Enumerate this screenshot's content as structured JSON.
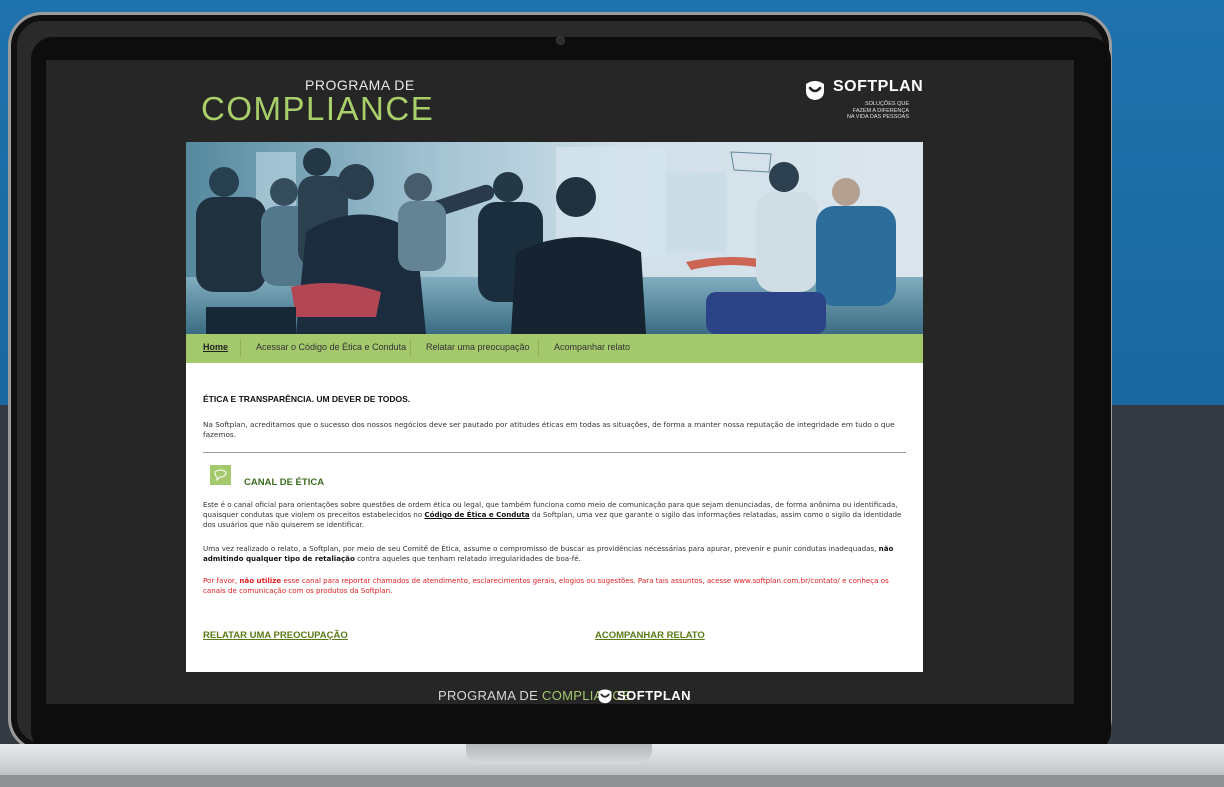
{
  "header": {
    "program_small": "PROGRAMA DE",
    "program_big": "COMPLIANCE",
    "logo_text": "SOFTPLAN",
    "logo_tagline_1": "SOLUÇÕES QUE",
    "logo_tagline_2": "FAZEM A DIFERENÇA",
    "logo_tagline_3": "NA VIDA DAS PESSOAS"
  },
  "nav": {
    "items": [
      {
        "label": "Home"
      },
      {
        "label": "Acessar o Código de Ética e Conduta"
      },
      {
        "label": "Relatar uma preocupação"
      },
      {
        "label": "Acompanhar relato"
      }
    ]
  },
  "content": {
    "heading": "ÉTICA E TRANSPARÊNCIA. UM DEVER DE TODOS.",
    "intro": "Na Softplan, acreditamos que o sucesso dos nossos negócios deve ser pautado por atitudes éticas em todas as situações, de forma a manter nossa reputação de integridade em tudo o que fazemos.",
    "canal_title": "CANAL DE ÉTICA",
    "p1_a": "Este é o canal oficial para orientações sobre questões de ordem ética ou legal, que também funciona como meio de comunicação para que sejam denunciadas, de forma anônima ou identificada, quaisquer condutas que violem os preceitos estabelecidos no ",
    "p1_link": "Código de Ética e Conduta",
    "p1_b": " da Softplan, uma vez que garante o sigilo das informações relatadas, assim como o sigilo da identidade dos usuários que não quiserem se identificar.",
    "p2_a": "Uma vez realizado o relato, a Softplan, por meio de seu Comitê de Ética, assume o compromisso de buscar as providências necessárias para apurar, prevenir e punir condutas inadequadas, ",
    "p2_bold": "não admitindo qualquer tipo de retaliação",
    "p2_b": " contra aqueles que tenham relatado irregularidades de boa-fé.",
    "p3_a": "Por favor, ",
    "p3_bold": "não utilize",
    "p3_b": " esse canal para reportar chamados de atendimento, esclarecimentos gerais, elogios ou sugestões.  Para tais assuntos, acesse www.softplan.com.br/contato/ e conheça os canais de comunicação com os produtos da Softplan."
  },
  "cta": {
    "report": "RELATAR UMA PREOCUPAÇÃO",
    "track": "ACOMPANHAR RELATO"
  },
  "footer": {
    "part1": "PROGRAMA DE ",
    "part2": "COMPLIANCE",
    "logo": "SOFTPLAN"
  },
  "colors": {
    "accent_green": "#a4c86c",
    "screen_bg": "#262626",
    "backdrop_blue": "#1e6fa8",
    "warning_red": "#e02020"
  }
}
